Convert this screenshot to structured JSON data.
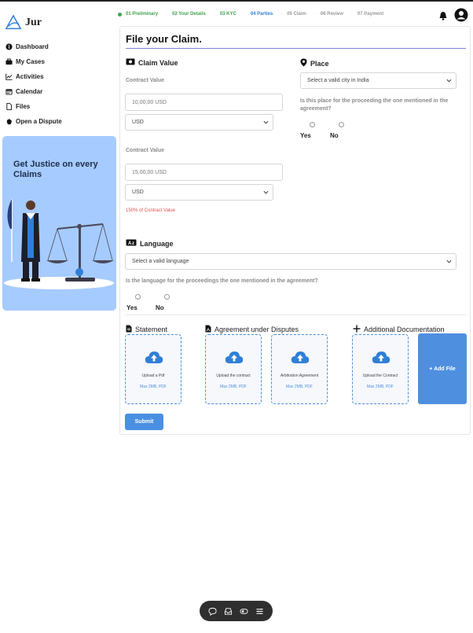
{
  "brand": {
    "name": "Jur"
  },
  "sidebar": {
    "items": [
      {
        "label": "Dashboard",
        "icon": "info-circle-icon"
      },
      {
        "label": "My Cases",
        "icon": "briefcase-icon"
      },
      {
        "label": "Activities",
        "icon": "chart-line-icon"
      },
      {
        "label": "Calendar",
        "icon": "calendar-icon"
      },
      {
        "label": "Files",
        "icon": "file-icon"
      },
      {
        "label": "Open a Dispute",
        "icon": "hand-icon"
      }
    ],
    "promo": {
      "title": "Get Justice on every Claims"
    }
  },
  "steps": [
    {
      "label": "01 Preliminary",
      "state": "done"
    },
    {
      "label": "02 Your Details",
      "state": "done"
    },
    {
      "label": "03 KYC",
      "state": "done"
    },
    {
      "label": "04 Parties",
      "state": "active"
    },
    {
      "label": "05 Claim",
      "state": "todo"
    },
    {
      "label": "06 Review",
      "state": "todo"
    },
    {
      "label": "07 Payment",
      "state": "todo"
    }
  ],
  "form": {
    "title": "File your Claim.",
    "claim_value": {
      "title": "Claim Value",
      "label1": "Contract Value",
      "input1_placeholder": "10,00,00 USD",
      "select1": "USD",
      "label2": "Contract Value",
      "input2_placeholder": "15,00,00 USD",
      "select2": "USD",
      "error": "150% of Contract Value"
    },
    "place": {
      "title": "Place",
      "select": "Select a valid city in India",
      "question": "Is this place for the proceeding the one mentioned in the agreement?",
      "yes": "Yes",
      "no": "No"
    },
    "language": {
      "title": "Language",
      "select": "Select a valid language",
      "question": "Is the language for the proceedings the one mentioned in the agreement?",
      "yes": "Yes",
      "no": "No"
    },
    "documents": {
      "statement_title": "Statement",
      "agreement_title": "Agreement under Disputes",
      "additional_title": "Additional Documentation",
      "uploads": [
        {
          "label": "Upload a Pdf",
          "meta": "Max 2MB, PDF"
        },
        {
          "label": "Upload the contract",
          "meta": "Max 2MB, PDF"
        },
        {
          "label": "Arbitration Agreement",
          "meta": "Max 2MB, PDF"
        },
        {
          "label": "Upload the Contract",
          "meta": "Max 2MB, PDF"
        }
      ],
      "add_file": "+ Add File"
    },
    "submit": "Submit"
  },
  "colors": {
    "accent": "#4a90e2",
    "done": "#3fa34d",
    "promo_bg": "#a6cbff",
    "error": "#e05050"
  }
}
